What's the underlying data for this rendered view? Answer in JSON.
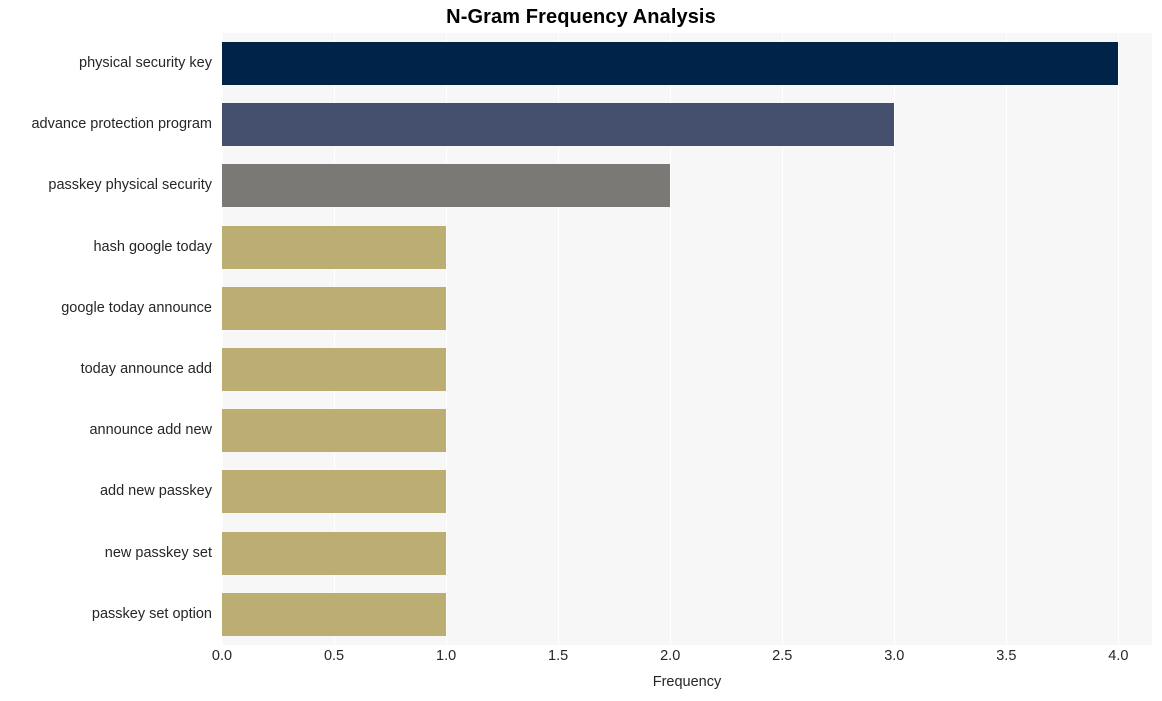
{
  "chart_data": {
    "type": "bar",
    "orientation": "horizontal",
    "title": "N-Gram Frequency Analysis",
    "xlabel": "Frequency",
    "ylabel": "",
    "xlim": [
      0,
      4.15
    ],
    "xticks": [
      "0.0",
      "0.5",
      "1.0",
      "1.5",
      "2.0",
      "2.5",
      "3.0",
      "3.5",
      "4.0"
    ],
    "xtick_values": [
      0,
      0.5,
      1.0,
      1.5,
      2.0,
      2.5,
      3.0,
      3.5,
      4.0
    ],
    "grid": true,
    "grid_color": "#ffffff",
    "plot_background": "#f7f7f7",
    "figure_background": "#ffffff",
    "legend": null,
    "categories": [
      "physical security key",
      "advance protection program",
      "passkey physical security",
      "hash google today",
      "google today announce",
      "today announce add",
      "announce add new",
      "add new passkey",
      "new passkey set",
      "passkey set option"
    ],
    "values": [
      4,
      3,
      2,
      1,
      1,
      1,
      1,
      1,
      1,
      1
    ],
    "bar_colors": [
      "#002349",
      "#454f6e",
      "#7b7975",
      "#bcae72",
      "#bcae72",
      "#bcae72",
      "#bcae72",
      "#bcae72",
      "#bcae72",
      "#bcae72"
    ],
    "bars": [
      {
        "label": "physical security key",
        "value": 4,
        "color": "#002349"
      },
      {
        "label": "advance protection program",
        "value": 3,
        "color": "#454f6e"
      },
      {
        "label": "passkey physical security",
        "value": 2,
        "color": "#7b7975"
      },
      {
        "label": "hash google today",
        "value": 1,
        "color": "#bcae72"
      },
      {
        "label": "google today announce",
        "value": 1,
        "color": "#bcae72"
      },
      {
        "label": "today announce add",
        "value": 1,
        "color": "#bcae72"
      },
      {
        "label": "announce add new",
        "value": 1,
        "color": "#bcae72"
      },
      {
        "label": "add new passkey",
        "value": 1,
        "color": "#bcae72"
      },
      {
        "label": "new passkey set",
        "value": 1,
        "color": "#bcae72"
      },
      {
        "label": "passkey set option",
        "value": 1,
        "color": "#bcae72"
      }
    ]
  }
}
